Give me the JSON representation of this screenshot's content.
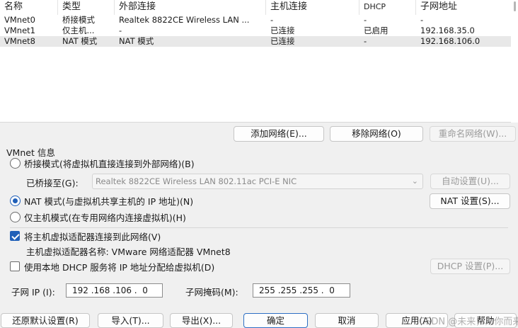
{
  "table": {
    "headers": [
      "名称",
      "类型",
      "外部连接",
      "主机连接",
      "DHCP",
      "子网地址"
    ],
    "rows": [
      {
        "name": "VMnet0",
        "type": "桥接模式",
        "external": "Realtek 8822CE Wireless LAN ...",
        "host": "-",
        "dhcp": "-",
        "subnet": "-"
      },
      {
        "name": "VMnet1",
        "type": "仅主机...",
        "external": "-",
        "host": "已连接",
        "dhcp": "已启用",
        "subnet": "192.168.35.0"
      },
      {
        "name": "VMnet8",
        "type": "NAT 模式",
        "external": "NAT 模式",
        "host": "已连接",
        "dhcp": "-",
        "subnet": "192.168.106.0"
      }
    ],
    "selected_row": 2
  },
  "table_buttons": {
    "add": "添加网络(E)...",
    "remove": "移除网络(O)",
    "rename": "重命名网络(W)..."
  },
  "vmnet_info": {
    "title": "VMnet 信息",
    "bridged_label": "桥接模式(将虚拟机直接连接到外部网络)(B)",
    "bridged_to_label": "已桥接至(G):",
    "bridged_to_value": "Realtek 8822CE Wireless LAN 802.11ac PCI-E NIC",
    "auto_settings": "自动设置(U)...",
    "nat_label": "NAT 模式(与虚拟机共享主机的 IP 地址)(N)",
    "nat_settings": "NAT 设置(S)...",
    "hostonly_label": "仅主机模式(在专用网络内连接虚拟机)(H)",
    "selected_mode": "nat",
    "connect_adapter_label": "将主机虚拟适配器连接到此网络(V)",
    "connect_adapter_checked": true,
    "adapter_name_text": "主机虚拟适配器名称: VMware 网络适配器 VMnet8",
    "dhcp_label": "使用本地 DHCP 服务将 IP 地址分配给虚拟机(D)",
    "dhcp_checked": false,
    "dhcp_settings": "DHCP 设置(P)...",
    "subnet_ip_label": "子网 IP (I):",
    "subnet_ip_value": "192 .168 .106 .  0",
    "subnet_mask_label": "子网掩码(M):",
    "subnet_mask_value": "255 .255 .255 .  0"
  },
  "bottom_buttons": {
    "restore": "还原默认设置(R)",
    "import": "导入(T)...",
    "export": "导出(X)...",
    "ok": "确定",
    "cancel": "取消",
    "apply": "应用(A)",
    "help": "帮助"
  },
  "watermark": "CSDN @未来，为你而来",
  "colors": {
    "background": "#f0f0f0",
    "accent": "#1f5fb8",
    "selected_row": "#e8e8e8",
    "disabled_text": "#9a9a9a"
  }
}
